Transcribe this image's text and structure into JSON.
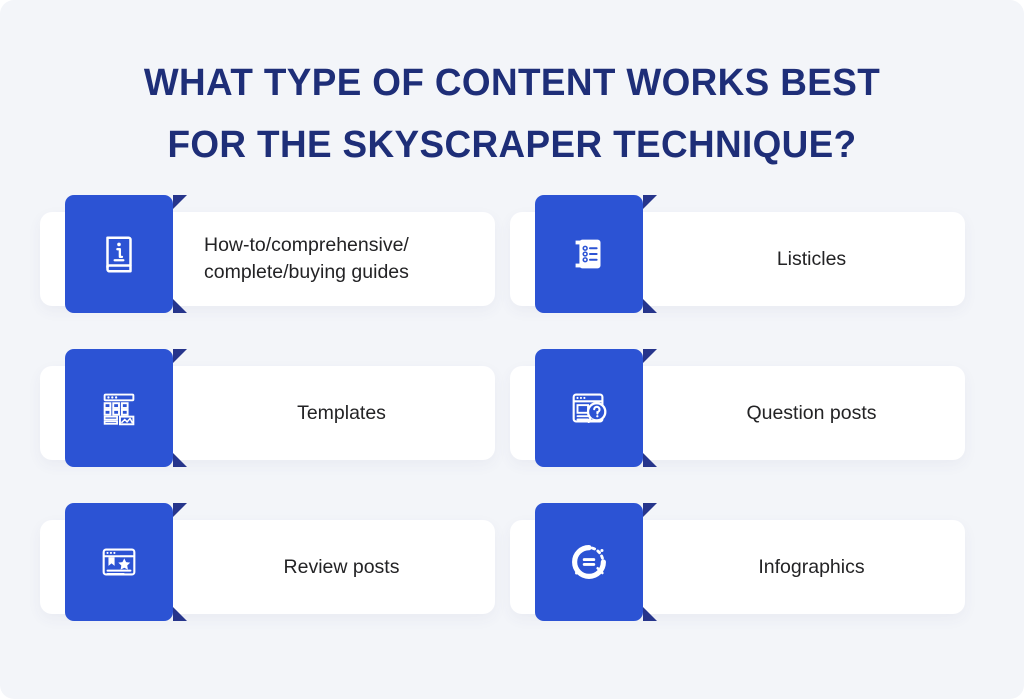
{
  "title": {
    "line1": "WHAT TYPE OF CONTENT WORKS BEST",
    "line2": "FOR THE SKYSCRAPER TECHNIQUE?"
  },
  "colors": {
    "background": "#f3f5f9",
    "title_navy": "#1e2e78",
    "tile_blue": "#2c53d4",
    "fold_navy": "#26358c",
    "card_white": "#ffffff",
    "label_text": "#232325"
  },
  "cards": [
    {
      "id": "guides",
      "label": "How-to/comprehensive/\ncomplete/buying guides",
      "icon": "book-info-icon",
      "align": "left"
    },
    {
      "id": "listicles",
      "label": "Listicles",
      "icon": "checklist-document-icon",
      "align": "center"
    },
    {
      "id": "templates",
      "label": "Templates",
      "icon": "layout-grid-icon",
      "align": "center"
    },
    {
      "id": "question-posts",
      "label": "Question posts",
      "icon": "browser-question-bubble-icon",
      "align": "center"
    },
    {
      "id": "review-posts",
      "label": "Review posts",
      "icon": "browser-star-bookmark-icon",
      "align": "center"
    },
    {
      "id": "infographics",
      "label": "Infographics",
      "icon": "donut-chart-icon",
      "align": "center"
    }
  ]
}
